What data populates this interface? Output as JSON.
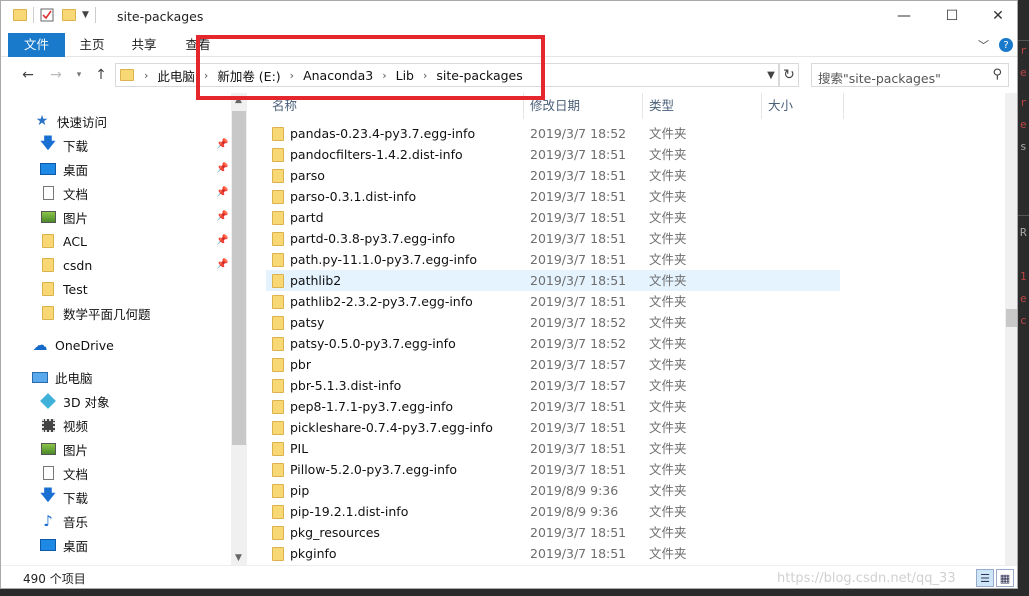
{
  "window": {
    "title": "site-packages",
    "controls": {
      "minimize": "—",
      "maximize": "☐",
      "close": "✕"
    }
  },
  "ribbon": {
    "tabs": [
      "文件",
      "主页",
      "共享",
      "查看"
    ],
    "expand_icon": "﹀",
    "help_icon": "?"
  },
  "address": {
    "crumbs": [
      "此电脑",
      "新加卷 (E:)",
      "Anaconda3",
      "Lib",
      "site-packages"
    ],
    "search_placeholder": "搜索\"site-packages\""
  },
  "navpane": {
    "items": [
      {
        "label": "快速访问",
        "icon": "star-icon",
        "pinned": false
      },
      {
        "label": "下载",
        "icon": "download-icon",
        "pinned": true
      },
      {
        "label": "桌面",
        "icon": "desktop-icon",
        "pinned": true
      },
      {
        "label": "文档",
        "icon": "documents-icon",
        "pinned": true
      },
      {
        "label": "图片",
        "icon": "pictures-icon",
        "pinned": true
      },
      {
        "label": "ACL",
        "icon": "folder-icon",
        "pinned": true
      },
      {
        "label": "csdn",
        "icon": "folder-icon",
        "pinned": true
      },
      {
        "label": "Test",
        "icon": "folder-icon",
        "pinned": false
      },
      {
        "label": "数学平面几何题",
        "icon": "folder-icon",
        "pinned": false
      },
      {
        "label": "OneDrive",
        "icon": "onedrive-icon",
        "pinned": false
      },
      {
        "label": "此电脑",
        "icon": "this-pc-icon",
        "pinned": false
      },
      {
        "label": "3D 对象",
        "icon": "3d-objects-icon",
        "pinned": false
      },
      {
        "label": "视频",
        "icon": "videos-icon",
        "pinned": false
      },
      {
        "label": "图片",
        "icon": "pictures-icon",
        "pinned": false
      },
      {
        "label": "文档",
        "icon": "documents-icon",
        "pinned": false
      },
      {
        "label": "下载",
        "icon": "download-icon",
        "pinned": false
      },
      {
        "label": "音乐",
        "icon": "music-icon",
        "pinned": false
      },
      {
        "label": "桌面",
        "icon": "desktop-icon",
        "pinned": false
      }
    ]
  },
  "filelist": {
    "columns": [
      "名称",
      "修改日期",
      "类型",
      "大小"
    ],
    "selected_index": 7,
    "rows": [
      {
        "name": "pandas-0.23.4-py3.7.egg-info",
        "date": "2019/3/7 18:52",
        "type": "文件夹"
      },
      {
        "name": "pandocfilters-1.4.2.dist-info",
        "date": "2019/3/7 18:51",
        "type": "文件夹"
      },
      {
        "name": "parso",
        "date": "2019/3/7 18:51",
        "type": "文件夹"
      },
      {
        "name": "parso-0.3.1.dist-info",
        "date": "2019/3/7 18:51",
        "type": "文件夹"
      },
      {
        "name": "partd",
        "date": "2019/3/7 18:51",
        "type": "文件夹"
      },
      {
        "name": "partd-0.3.8-py3.7.egg-info",
        "date": "2019/3/7 18:51",
        "type": "文件夹"
      },
      {
        "name": "path.py-11.1.0-py3.7.egg-info",
        "date": "2019/3/7 18:51",
        "type": "文件夹"
      },
      {
        "name": "pathlib2",
        "date": "2019/3/7 18:51",
        "type": "文件夹"
      },
      {
        "name": "pathlib2-2.3.2-py3.7.egg-info",
        "date": "2019/3/7 18:51",
        "type": "文件夹"
      },
      {
        "name": "patsy",
        "date": "2019/3/7 18:52",
        "type": "文件夹"
      },
      {
        "name": "patsy-0.5.0-py3.7.egg-info",
        "date": "2019/3/7 18:52",
        "type": "文件夹"
      },
      {
        "name": "pbr",
        "date": "2019/3/7 18:57",
        "type": "文件夹"
      },
      {
        "name": "pbr-5.1.3.dist-info",
        "date": "2019/3/7 18:57",
        "type": "文件夹"
      },
      {
        "name": "pep8-1.7.1-py3.7.egg-info",
        "date": "2019/3/7 18:51",
        "type": "文件夹"
      },
      {
        "name": "pickleshare-0.7.4-py3.7.egg-info",
        "date": "2019/3/7 18:51",
        "type": "文件夹"
      },
      {
        "name": "PIL",
        "date": "2019/3/7 18:51",
        "type": "文件夹"
      },
      {
        "name": "Pillow-5.2.0-py3.7.egg-info",
        "date": "2019/3/7 18:51",
        "type": "文件夹"
      },
      {
        "name": "pip",
        "date": "2019/8/9 9:36",
        "type": "文件夹"
      },
      {
        "name": "pip-19.2.1.dist-info",
        "date": "2019/8/9 9:36",
        "type": "文件夹"
      },
      {
        "name": "pkg_resources",
        "date": "2019/3/7 18:51",
        "type": "文件夹"
      },
      {
        "name": "pkginfo",
        "date": "2019/3/7 18:51",
        "type": "文件夹"
      }
    ]
  },
  "status": {
    "item_count": "490 个项目",
    "watermark": "https://blog.csdn.net/qq_33"
  },
  "colors": {
    "accent": "#1979ca",
    "selection": "#e5f3ff",
    "highlight_box": "#e5272d"
  }
}
